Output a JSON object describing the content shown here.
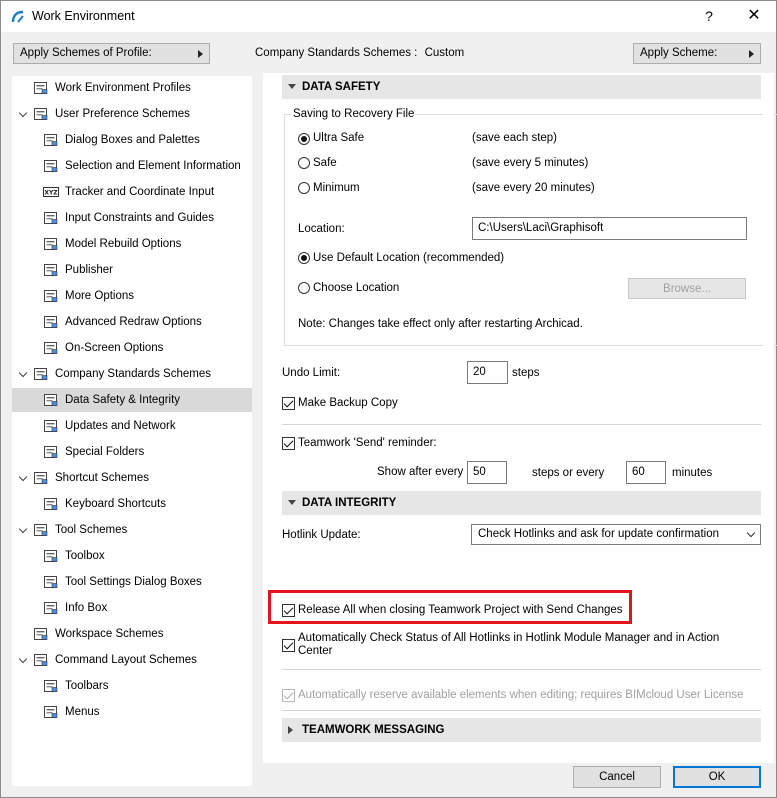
{
  "window": {
    "title": "Work Environment",
    "help": "?",
    "close": "✕"
  },
  "toolbar": {
    "apply_profile": "Apply Schemes of Profile:",
    "company_label": "Company Standards Schemes :",
    "company_value": "Custom",
    "apply_scheme": "Apply Scheme:"
  },
  "tree": [
    {
      "label": "Work Environment Profiles",
      "icon": "profiles-icon"
    },
    {
      "label": "User Preference Schemes",
      "icon": "user-preference-icon"
    },
    {
      "label": "Dialog Boxes and Palettes",
      "icon": "dialog-boxes-icon"
    },
    {
      "label": "Selection and Element Information",
      "icon": "selection-icon"
    },
    {
      "label": "Tracker and Coordinate Input",
      "icon": "tracker-icon",
      "badge": "XYZ"
    },
    {
      "label": "Input Constraints and Guides",
      "icon": "input-constraints-icon"
    },
    {
      "label": "Model Rebuild Options",
      "icon": "model-rebuild-icon"
    },
    {
      "label": "Publisher",
      "icon": "publisher-icon"
    },
    {
      "label": "More Options",
      "icon": "more-options-icon"
    },
    {
      "label": "Advanced Redraw Options",
      "icon": "advanced-redraw-icon"
    },
    {
      "label": "On-Screen Options",
      "icon": "on-screen-icon"
    },
    {
      "label": "Company Standards Schemes",
      "icon": "company-standards-icon"
    },
    {
      "label": "Data Safety & Integrity",
      "icon": "data-safety-icon"
    },
    {
      "label": "Updates and Network",
      "icon": "globe-icon"
    },
    {
      "label": "Special Folders",
      "icon": "folder-icon"
    },
    {
      "label": "Shortcut Schemes",
      "icon": "shortcut-schemes-icon"
    },
    {
      "label": "Keyboard Shortcuts",
      "icon": "keyboard-shortcuts-icon"
    },
    {
      "label": "Tool Schemes",
      "icon": "tool-schemes-icon"
    },
    {
      "label": "Toolbox",
      "icon": "toolbox-icon"
    },
    {
      "label": "Tool Settings Dialog Boxes",
      "icon": "tool-settings-icon"
    },
    {
      "label": "Info Box",
      "icon": "info-box-icon"
    },
    {
      "label": "Workspace Schemes",
      "icon": "workspace-icon"
    },
    {
      "label": "Command Layout Schemes",
      "icon": "command-layout-icon"
    },
    {
      "label": "Toolbars",
      "icon": "toolbars-icon"
    },
    {
      "label": "Menus",
      "icon": "menus-icon"
    }
  ],
  "data_safety": {
    "header": "DATA SAFETY",
    "group_title": "Saving to Recovery File",
    "options": [
      {
        "label": "Ultra Safe",
        "desc": "(save each step)",
        "selected": true
      },
      {
        "label": "Safe",
        "desc": "(save every 5 minutes)",
        "selected": false
      },
      {
        "label": "Minimum",
        "desc": "(save every 20 minutes)",
        "selected": false
      }
    ],
    "location_label": "Location:",
    "location_value": "C:\\Users\\Laci\\Graphisoft",
    "use_default": "Use Default Location (recommended)",
    "choose_location": "Choose Location",
    "browse": "Browse...",
    "note": "Note: Changes take effect only after restarting Archicad.",
    "undo_label": "Undo Limit:",
    "undo_value": "20",
    "undo_unit": "steps",
    "backup": "Make Backup Copy",
    "teamwork_reminder": "Teamwork 'Send' reminder:",
    "show_after": "Show after every",
    "show_steps_value": "50",
    "steps_or_every": "steps or every",
    "show_minutes_value": "60",
    "minutes": "minutes"
  },
  "data_integrity": {
    "header": "DATA INTEGRITY",
    "hotlink_label": "Hotlink Update:",
    "hotlink_value": "Check Hotlinks and ask for update confirmation",
    "release_all": "Release All when closing Teamwork Project with Send Changes",
    "auto_check_line1": "Automatically Check Status of All Hotlinks in Hotlink Module Manager and in Action",
    "auto_check_line2": "Center",
    "auto_reserve": "Automatically reserve available elements when editing; requires BIMcloud User License"
  },
  "teamwork_messaging": {
    "header": "TEAMWORK MESSAGING"
  },
  "footer": {
    "cancel": "Cancel",
    "ok": "OK"
  },
  "colors": {
    "highlight": "#e5141a",
    "selected_row": "#d9d9d9",
    "section_header": "#e6e6e6"
  }
}
